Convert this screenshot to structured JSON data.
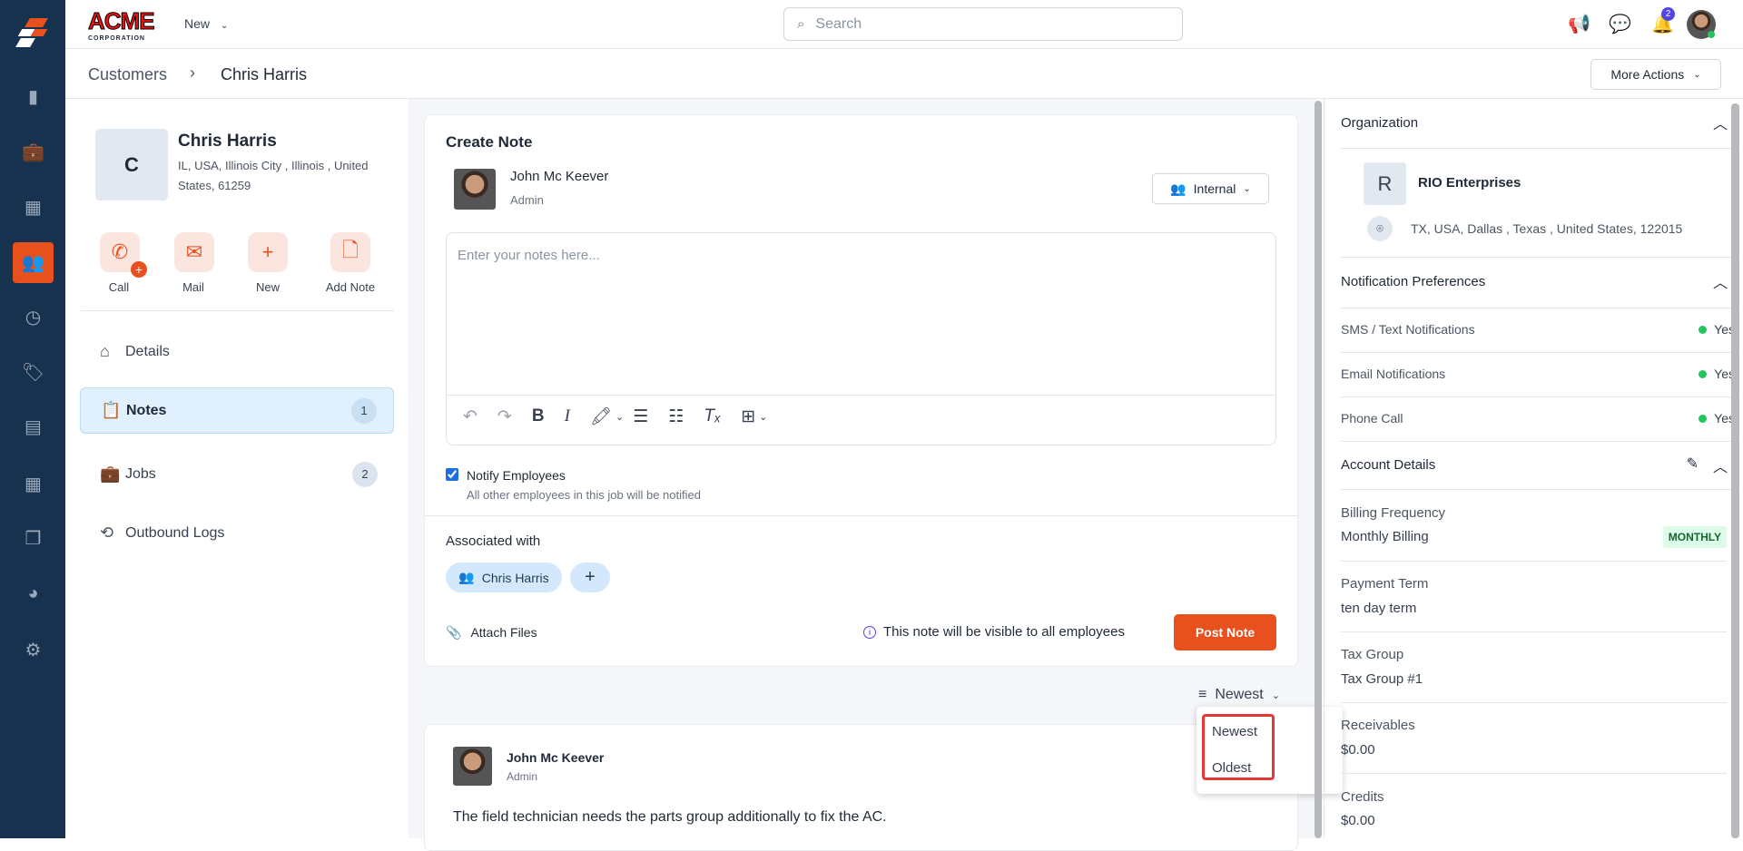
{
  "nav": {
    "items": [
      "reports",
      "jobs",
      "calendar",
      "customers",
      "time",
      "tags",
      "map",
      "calculator",
      "documents",
      "analytics",
      "settings"
    ]
  },
  "header": {
    "logo": "ACME CORPORATION",
    "new_label": "New",
    "search_placeholder": "Search",
    "notification_count": "2"
  },
  "breadcrumb": {
    "parent": "Customers",
    "current": "Chris Harris",
    "more_actions": "More Actions"
  },
  "customer": {
    "initial": "C",
    "name": "Chris Harris",
    "address": "IL, USA, Illinois City , Illinois , United States, 61259",
    "actions": [
      "Call",
      "Mail",
      "New",
      "Add Note"
    ],
    "menu": [
      {
        "label": "Details"
      },
      {
        "label": "Notes",
        "count": "1"
      },
      {
        "label": "Jobs",
        "count": "2"
      },
      {
        "label": "Outbound Logs"
      }
    ]
  },
  "create_note": {
    "title": "Create Note",
    "author": "John Mc Keever",
    "role": "Admin",
    "visibility": "Internal",
    "placeholder": "Enter your notes here...",
    "notify_label": "Notify Employees",
    "notify_sub": "All other employees in this job will be notified",
    "notify_checked": true,
    "associated_label": "Associated with",
    "associated_chip": "Chris Harris",
    "attach_label": "Attach Files",
    "visible_info": "This note will be visible to all employees",
    "post_label": "Post Note"
  },
  "sort": {
    "selected": "Newest",
    "options": [
      "Newest",
      "Oldest"
    ]
  },
  "note": {
    "author": "John Mc Keever",
    "role": "Admin",
    "text": "The field technician needs the parts group additionally to fix the AC."
  },
  "organization": {
    "title": "Organization",
    "initial": "R",
    "name": "RIO Enterprises",
    "address": "TX, USA, Dallas , Texas , United States, 122015"
  },
  "notifications": {
    "title": "Notification Preferences",
    "rows": [
      {
        "label": "SMS / Text Notifications",
        "value": "Yes"
      },
      {
        "label": "Email Notifications",
        "value": "Yes"
      },
      {
        "label": "Phone Call",
        "value": "Yes"
      }
    ]
  },
  "account": {
    "title": "Account Details",
    "billing_label": "Billing Frequency",
    "billing_value": "Monthly Billing",
    "billing_badge": "MONTHLY",
    "payment_label": "Payment Term",
    "payment_value": "ten day term",
    "tax_label": "Tax Group",
    "tax_value": "Tax Group #1",
    "recv_label": "Receivables",
    "recv_value": "$0.00",
    "credits_label": "Credits",
    "credits_value": "$0.00"
  }
}
